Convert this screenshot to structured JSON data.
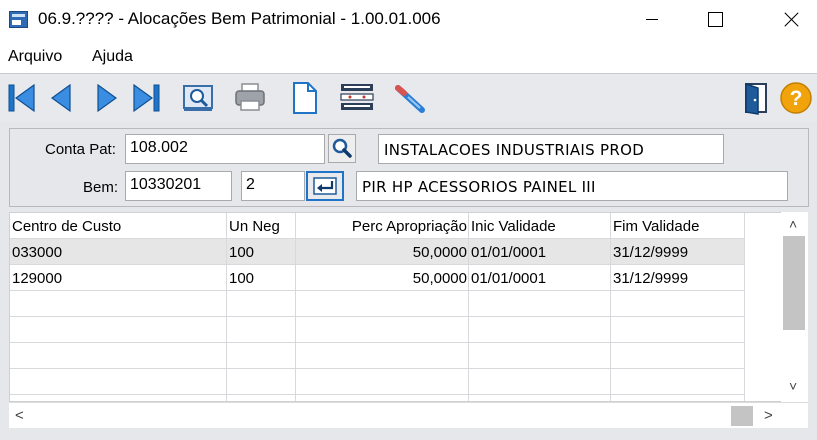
{
  "window": {
    "title": "06.9.???? - Alocações Bem Patrimonial - 1.00.01.006",
    "app_icon": "app-window-icon",
    "controls": [
      "minimize-icon",
      "maximize-icon",
      "close-icon"
    ]
  },
  "menu": {
    "items": [
      {
        "label": "Arquivo"
      },
      {
        "label": "Ajuda"
      }
    ]
  },
  "toolbar": {
    "buttons": [
      "first-record-icon",
      "previous-record-icon",
      "next-record-icon",
      "last-record-icon",
      "zoom-icon",
      "print-icon",
      "new-document-icon",
      "list-icon",
      "edit-icon",
      "exit-door-icon",
      "help-icon"
    ],
    "colors": {
      "accent": "#1f74c7",
      "help": "#f0a30a"
    }
  },
  "form": {
    "conta_pat": {
      "label": "Conta Pat:",
      "value": "108.002",
      "description": "INSTALACOES INDUSTRIAIS PROD"
    },
    "bem": {
      "label": "Bem:",
      "value": "10330201",
      "incorporacao": "2",
      "description": "PIR HP ACESSORIOS PAINEL III"
    }
  },
  "grid": {
    "columns": [
      "Centro de Custo",
      "Un Neg",
      "Perc Apropriação",
      "Inic Validade",
      "Fim Validade"
    ],
    "rows": [
      [
        "033000",
        "100",
        "50,0000",
        "01/01/0001",
        "31/12/9999"
      ],
      [
        "129000",
        "100",
        "50,0000",
        "01/01/0001",
        "31/12/9999"
      ]
    ],
    "selected_row": 0
  },
  "scroll": {
    "up": "˄",
    "down": "˅",
    "left": "<",
    "right": ">"
  }
}
